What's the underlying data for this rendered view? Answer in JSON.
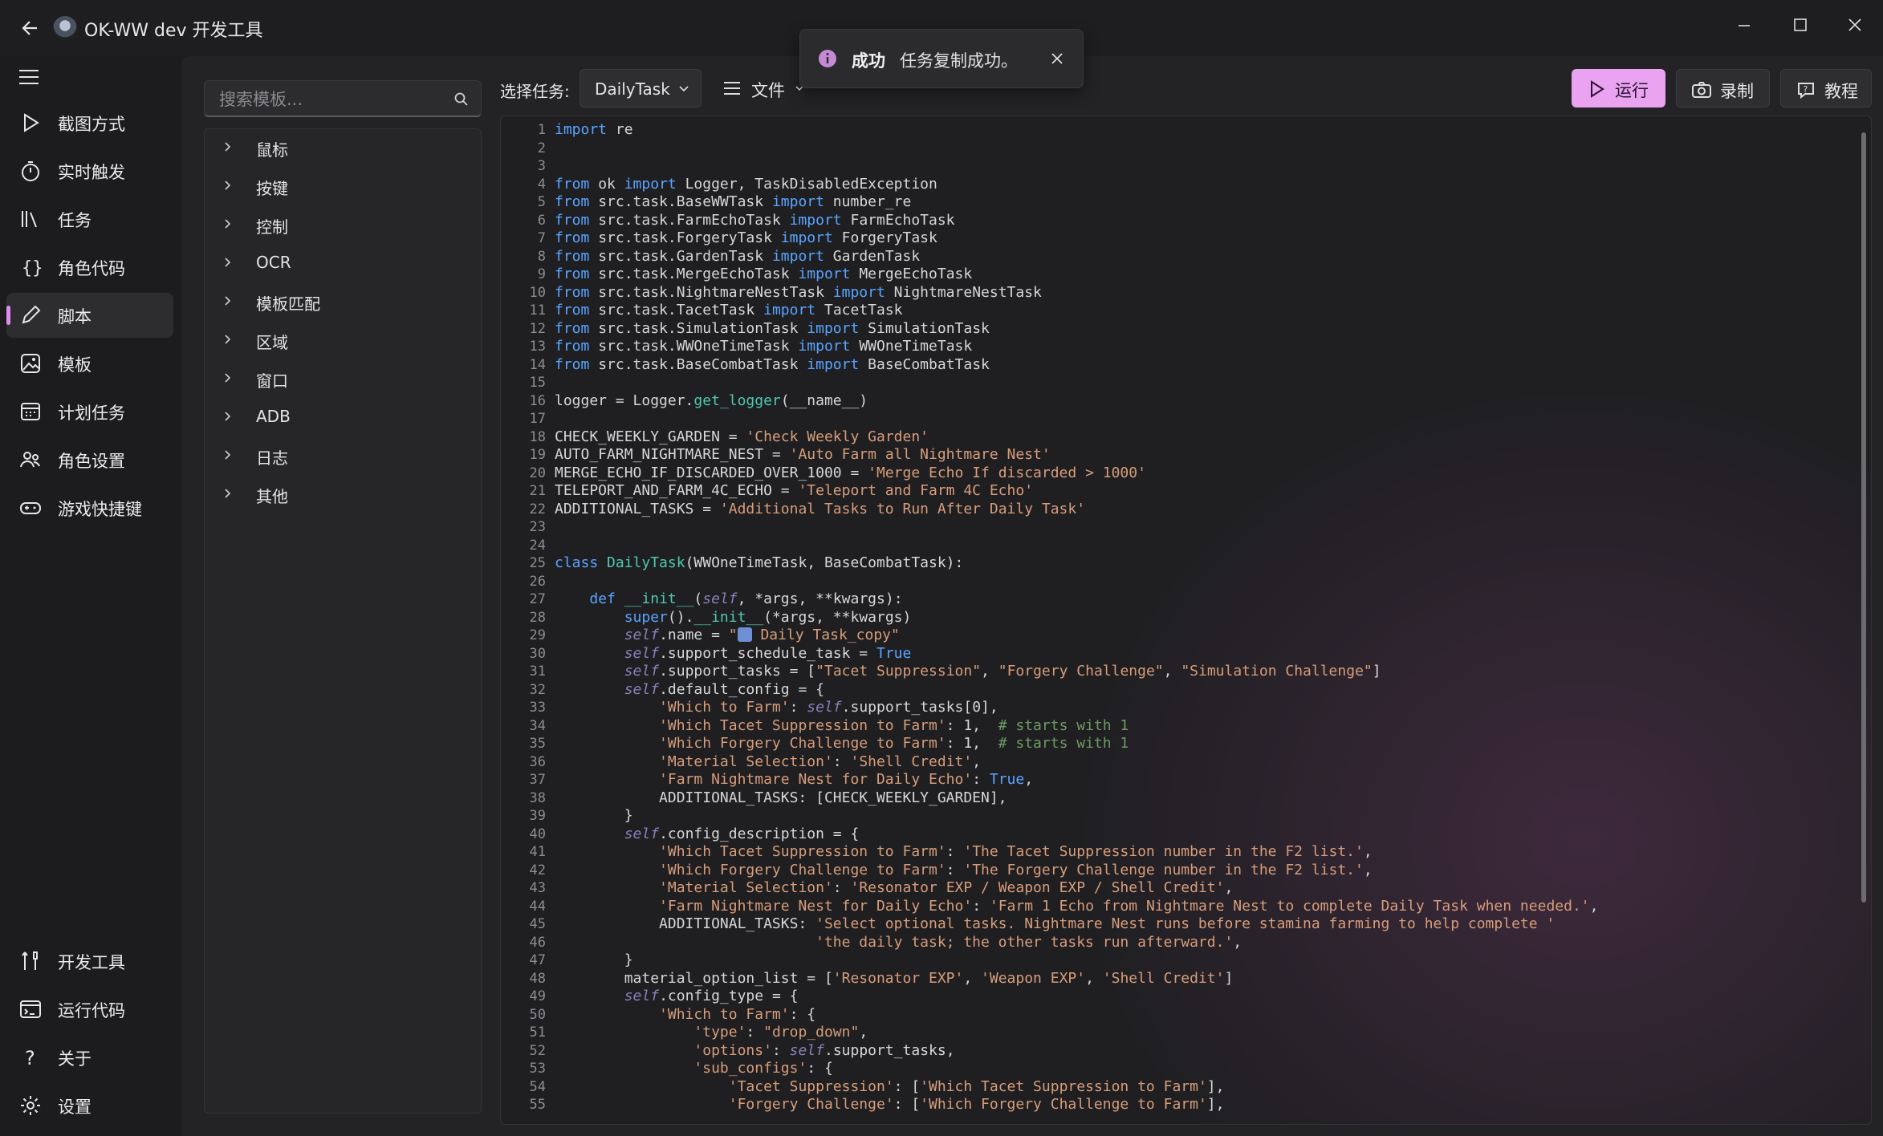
{
  "window": {
    "title": "OK-WW dev  开发工具"
  },
  "nav": {
    "items": [
      {
        "label": "截图方式",
        "icon": "play-icon"
      },
      {
        "label": "实时触发",
        "icon": "stopwatch-icon"
      },
      {
        "label": "任务",
        "icon": "library-icon"
      },
      {
        "label": "角色代码",
        "icon": "braces-icon"
      },
      {
        "label": "脚本",
        "icon": "pencil-icon",
        "active": true
      },
      {
        "label": "模板",
        "icon": "image-icon"
      },
      {
        "label": "计划任务",
        "icon": "calendar-icon"
      },
      {
        "label": "角色设置",
        "icon": "people-icon"
      },
      {
        "label": "游戏快捷键",
        "icon": "gamepad-icon"
      }
    ],
    "bottom": [
      {
        "label": "开发工具",
        "icon": "devtools-icon"
      },
      {
        "label": "运行代码",
        "icon": "console-icon"
      },
      {
        "label": "关于",
        "icon": "question-icon"
      },
      {
        "label": "设置",
        "icon": "gear-icon"
      }
    ]
  },
  "templates": {
    "search_placeholder": "搜索模板...",
    "items": [
      "鼠标",
      "按键",
      "控制",
      "OCR",
      "模板匹配",
      "区域",
      "窗口",
      "ADB",
      "日志",
      "其他"
    ]
  },
  "toolbar": {
    "select_label": "选择任务:",
    "selected_task": "DailyTask",
    "file_label": "文件",
    "run_label": "运行",
    "record_label": "录制",
    "tutorial_label": "教程"
  },
  "toast": {
    "title": "成功",
    "message": "任务复制成功。"
  },
  "colors": {
    "accent": "#e9a3f1",
    "keyword": "#5aa4ff",
    "string": "#d89d7a",
    "comment": "#6f9a63"
  },
  "code": {
    "lines": [
      "import re",
      "",
      "",
      "from ok import Logger, TaskDisabledException",
      "from src.task.BaseWWTask import number_re",
      "from src.task.FarmEchoTask import FarmEchoTask",
      "from src.task.ForgeryTask import ForgeryTask",
      "from src.task.GardenTask import GardenTask",
      "from src.task.MergeEchoTask import MergeEchoTask",
      "from src.task.NightmareNestTask import NightmareNestTask",
      "from src.task.TacetTask import TacetTask",
      "from src.task.SimulationTask import SimulationTask",
      "from src.task.WWOneTimeTask import WWOneTimeTask",
      "from src.task.BaseCombatTask import BaseCombatTask",
      "",
      "logger = Logger.get_logger(__name__)",
      "",
      "CHECK_WEEKLY_GARDEN = 'Check Weekly Garden'",
      "AUTO_FARM_NIGHTMARE_NEST = 'Auto Farm all Nightmare Nest'",
      "MERGE_ECHO_IF_DISCARDED_OVER_1000 = 'Merge Echo If discarded > 1000'",
      "TELEPORT_AND_FARM_4C_ECHO = 'Teleport and Farm 4C Echo'",
      "ADDITIONAL_TASKS = 'Additional Tasks to Run After Daily Task'",
      "",
      "",
      "class DailyTask(WWOneTimeTask, BaseCombatTask):",
      "",
      "    def __init__(self, *args, **kwargs):",
      "        super().__init__(*args, **kwargs)",
      "        self.name = \"📅 Daily Task_copy\"",
      "        self.support_schedule_task = True",
      "        self.support_tasks = [\"Tacet Suppression\", \"Forgery Challenge\", \"Simulation Challenge\"]",
      "        self.default_config = {",
      "            'Which to Farm': self.support_tasks[0],",
      "            'Which Tacet Suppression to Farm': 1,  # starts with 1",
      "            'Which Forgery Challenge to Farm': 1,  # starts with 1",
      "            'Material Selection': 'Shell Credit',",
      "            'Farm Nightmare Nest for Daily Echo': True,",
      "            ADDITIONAL_TASKS: [CHECK_WEEKLY_GARDEN],",
      "        }",
      "        self.config_description = {",
      "            'Which Tacet Suppression to Farm': 'The Tacet Suppression number in the F2 list.',",
      "            'Which Forgery Challenge to Farm': 'The Forgery Challenge number in the F2 list.',",
      "            'Material Selection': 'Resonator EXP / Weapon EXP / Shell Credit',",
      "            'Farm Nightmare Nest for Daily Echo': 'Farm 1 Echo from Nightmare Nest to complete Daily Task when needed.',",
      "            ADDITIONAL_TASKS: 'Select optional tasks. Nightmare Nest runs before stamina farming to help complete '",
      "                              'the daily task; the other tasks run afterward.',",
      "        }",
      "        material_option_list = ['Resonator EXP', 'Weapon EXP', 'Shell Credit']",
      "        self.config_type = {",
      "            'Which to Farm': {",
      "                'type': \"drop_down\",",
      "                'options': self.support_tasks,",
      "                'sub_configs': {",
      "                    'Tacet Suppression': ['Which Tacet Suppression to Farm'],",
      "                    'Forgery Challenge': ['Which Forgery Challenge to Farm'],"
    ]
  }
}
